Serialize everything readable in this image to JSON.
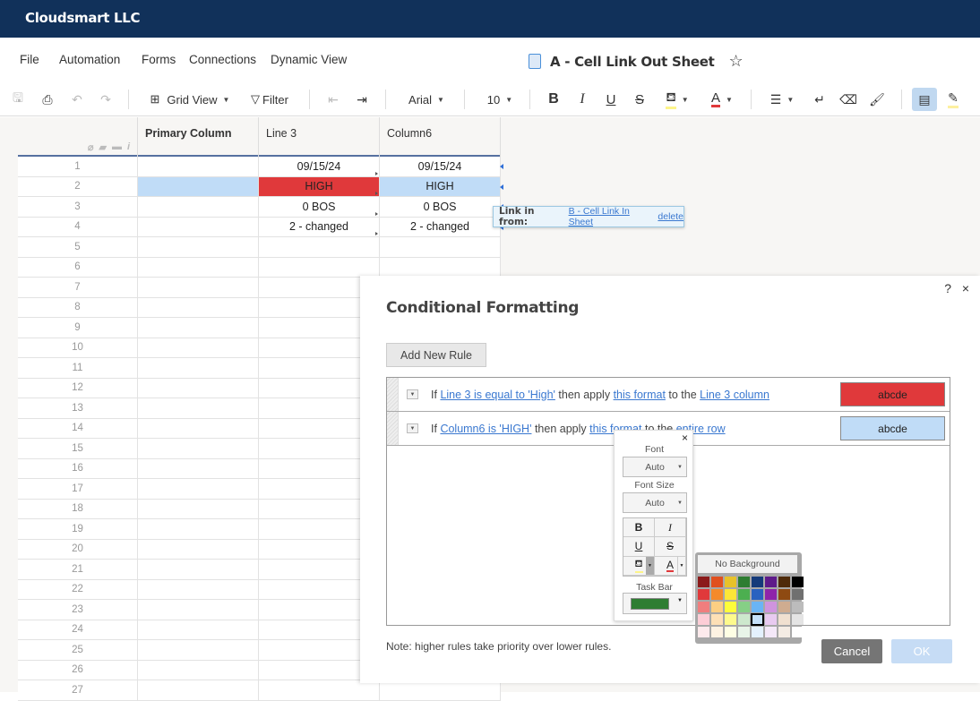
{
  "app": {
    "org_name": "Cloudsmart LLC"
  },
  "menu": {
    "items": [
      "File",
      "Automation",
      "Forms",
      "Connections",
      "Dynamic View"
    ]
  },
  "sheet": {
    "title": "A - Cell Link Out Sheet"
  },
  "toolbar": {
    "view_label": "Grid View",
    "filter_label": "Filter",
    "font_family": "Arial",
    "font_size": "10",
    "bold": "B",
    "italic": "I",
    "underline": "U",
    "strike": "S",
    "text_color": "A"
  },
  "grid": {
    "columns": [
      "Primary Column",
      "Line 3",
      "Column6"
    ],
    "rows": [
      {
        "num": "1",
        "primary": "",
        "line3": "09/15/24",
        "col6": "09/15/24"
      },
      {
        "num": "2",
        "primary": "",
        "line3": "HIGH",
        "col6": "HIGH"
      },
      {
        "num": "3",
        "primary": "",
        "line3": "0 BOS",
        "col6": "0 BOS"
      },
      {
        "num": "4",
        "primary": "",
        "line3": "2 - changed",
        "col6": "2 - changed"
      },
      {
        "num": "5"
      },
      {
        "num": "6"
      },
      {
        "num": "7"
      },
      {
        "num": "8"
      },
      {
        "num": "9"
      },
      {
        "num": "10"
      },
      {
        "num": "11"
      },
      {
        "num": "12"
      },
      {
        "num": "13"
      },
      {
        "num": "14"
      },
      {
        "num": "15"
      },
      {
        "num": "16"
      },
      {
        "num": "17"
      },
      {
        "num": "18"
      },
      {
        "num": "19"
      },
      {
        "num": "20"
      },
      {
        "num": "21"
      },
      {
        "num": "22"
      },
      {
        "num": "23"
      },
      {
        "num": "24"
      },
      {
        "num": "25"
      },
      {
        "num": "26"
      },
      {
        "num": "27"
      }
    ]
  },
  "link_popup": {
    "label": "Link in from:",
    "source": "B - Cell Link In Sheet",
    "delete": "delete"
  },
  "dialog": {
    "title": "Conditional Formatting",
    "help": "?",
    "close": "×",
    "add_rule": "Add New Rule",
    "rules": [
      {
        "if": "If",
        "condition": "Line 3 is equal to 'High'",
        "then": "then apply",
        "format_link": "this format",
        "to": "to the",
        "target": "Line 3 column",
        "preview": "abcde",
        "preview_bg": "#e0393b"
      },
      {
        "if": "If",
        "condition": "Column6 is 'HIGH'",
        "then": "then apply",
        "format_link": "this format",
        "to": "to the",
        "target": "entire row",
        "preview": "abcde",
        "preview_bg": "#c0dcf7"
      }
    ],
    "note": "Note: higher rules take priority over lower rules.",
    "cancel": "Cancel",
    "ok": "OK"
  },
  "format_popup": {
    "close": "×",
    "font_label": "Font",
    "font_value": "Auto",
    "size_label": "Font Size",
    "size_value": "Auto",
    "taskbar_label": "Task Bar",
    "taskbar_color": "#2e7d32"
  },
  "palette": {
    "no_bg": "No Background",
    "selected": "#c5e0fa",
    "colors": [
      "#8b1a1a",
      "#e0501f",
      "#e8c22a",
      "#2e7d32",
      "#143a7a",
      "#5e1a8a",
      "#4e2a0a",
      "#000000",
      "#e0393b",
      "#f58a2a",
      "#fde637",
      "#4caf50",
      "#2962c0",
      "#8e24aa",
      "#8e4a12",
      "#707070",
      "#f07e7e",
      "#fccf83",
      "#fdfd3a",
      "#86cf86",
      "#6ab4f5",
      "#cf94de",
      "#cfac90",
      "#bcbcbc",
      "#fdcdd6",
      "#fde0b6",
      "#fdfa8c",
      "#cde8cd",
      "#c5e0fa",
      "#e8caf0",
      "#f0e0d0",
      "#e4e4e4",
      "#fdeaec",
      "#fdf2e2",
      "#fefee4",
      "#e8f4e8",
      "#e4f1fd",
      "#f4e8f8",
      "#f4ece4",
      "#ffffff"
    ]
  }
}
